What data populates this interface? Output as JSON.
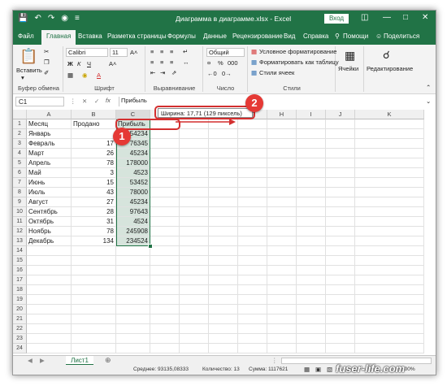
{
  "window": {
    "title": "Диаграмма в диаграмме.xlsx  -  Excel",
    "sign_in": "Вход",
    "accent": "#217346"
  },
  "quick_access": [
    "save-icon",
    "undo-icon",
    "redo-icon",
    "camera-icon",
    "customize-icon"
  ],
  "tabs": [
    {
      "label": "Файл"
    },
    {
      "label": "Главная",
      "active": true
    },
    {
      "label": "Вставка"
    },
    {
      "label": "Разметка страницы"
    },
    {
      "label": "Формулы"
    },
    {
      "label": "Данные"
    },
    {
      "label": "Рецензирование"
    },
    {
      "label": "Вид"
    },
    {
      "label": "Справка"
    },
    {
      "label": "Помощи"
    },
    {
      "label": "Поделиться"
    }
  ],
  "ribbon": {
    "clipboard": {
      "label": "Буфер обмена",
      "paste": "Вставить"
    },
    "font": {
      "label": "Шрифт",
      "name": "Calibri",
      "size": "11",
      "bold": "Ж",
      "italic": "К",
      "underline": "Ч"
    },
    "alignment": {
      "label": "Выравнивание"
    },
    "number": {
      "label": "Число",
      "format": "Общий",
      "percent": "%",
      "thousands": "000"
    },
    "styles": {
      "label": "Стили",
      "conditional": "Условное форматирование",
      "as_table": "Форматировать как таблицу",
      "cell_styles": "Стили ячеек"
    },
    "cells": {
      "label": "Ячейки"
    },
    "editing": {
      "label": "Редактирование"
    }
  },
  "formula_bar": {
    "name_box": "C1",
    "fx": "fx",
    "content": "Прибыль"
  },
  "columns": [
    "A",
    "B",
    "C",
    "D",
    "E",
    "F",
    "G",
    "H",
    "I",
    "J",
    "K"
  ],
  "sheet": {
    "headers": [
      "Месяц",
      "Продано",
      "Прибыль"
    ],
    "rows": [
      [
        "Январь",
        "",
        "54234"
      ],
      [
        "Февраль",
        "17",
        "76345"
      ],
      [
        "Март",
        "26",
        "45234"
      ],
      [
        "Апрель",
        "78",
        "178000"
      ],
      [
        "Май",
        "3",
        "4523"
      ],
      [
        "Июнь",
        "15",
        "53452"
      ],
      [
        "Июль",
        "43",
        "78000"
      ],
      [
        "Август",
        "27",
        "45234"
      ],
      [
        "Сентябрь",
        "28",
        "97643"
      ],
      [
        "Октябрь",
        "31",
        "4524"
      ],
      [
        "Ноябрь",
        "78",
        "245908"
      ],
      [
        "Декабрь",
        "134",
        "234524"
      ]
    ],
    "row_count": 24
  },
  "tooltip": "Ширина: 17,71 (129 пиксель)",
  "markers": [
    "1",
    "2"
  ],
  "sheet_tab": "Лист1",
  "status": {
    "average": "Среднее: 93135,08333",
    "count": "Количество: 13",
    "sum": "Сумма: 1117621",
    "zoom": "100%"
  },
  "watermark": "fuser-life.com"
}
